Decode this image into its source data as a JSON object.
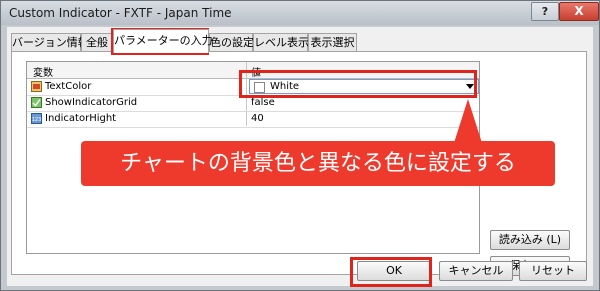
{
  "window": {
    "title": "Custom Indicator - FXTF - Japan Time",
    "help_label": "?",
    "close_label": "X"
  },
  "tabs": [
    {
      "label": "バージョン情報"
    },
    {
      "label": "全般"
    },
    {
      "label": "パラメーターの入力"
    },
    {
      "label": "色の設定"
    },
    {
      "label": "レベル表示"
    },
    {
      "label": "表示選択"
    }
  ],
  "grid": {
    "columns": [
      "変数",
      "値"
    ],
    "rows": [
      {
        "name": "TextColor",
        "value": "White",
        "icon": "color-icon"
      },
      {
        "name": "ShowIndicatorGrid",
        "value": "false",
        "icon": "bool-icon"
      },
      {
        "name": "IndicatorHight",
        "value": "40",
        "icon": "int-icon"
      }
    ]
  },
  "side_buttons": {
    "load": "読み込み (L)",
    "save": "保存 (S)"
  },
  "footer_buttons": {
    "ok": "OK",
    "cancel": "キャンセル",
    "reset": "リセット"
  },
  "callout": {
    "text": "チャートの背景色と異なる色に設定する"
  },
  "colors": {
    "highlight": "#e0241c",
    "callout": "#ee3a2c"
  }
}
